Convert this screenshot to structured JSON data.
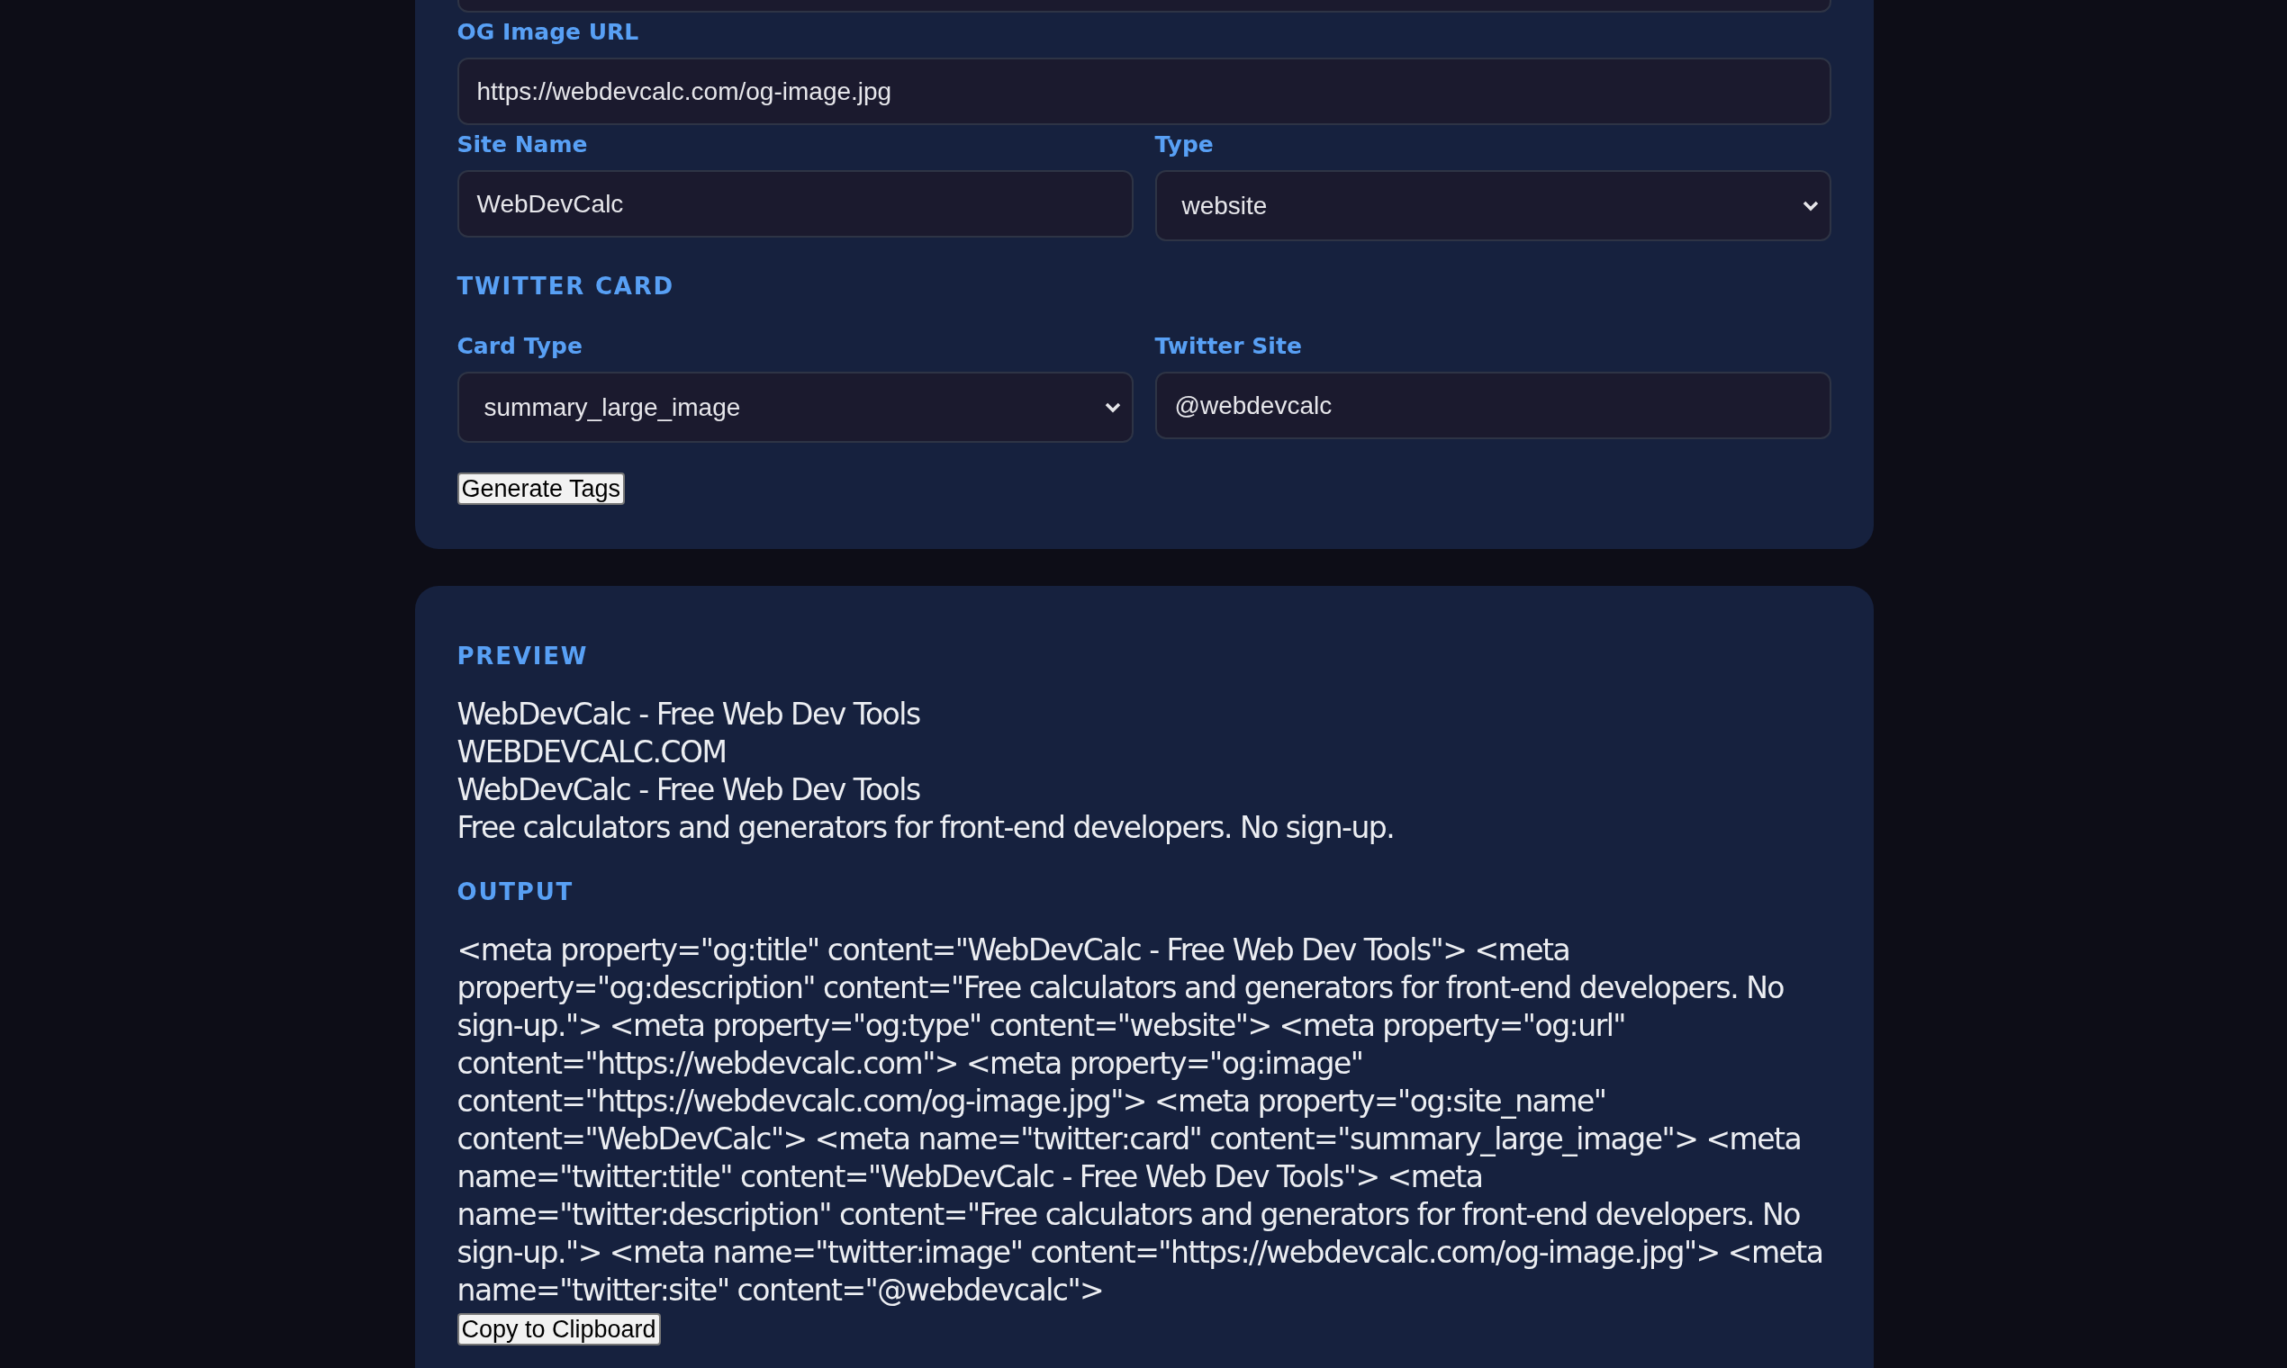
{
  "form_card": {
    "items": [
      {
        "kind": "cut_field"
      },
      {
        "kind": "input",
        "label": "OG Image URL",
        "value": "https://webdevcalc.com/og-image.jpg"
      },
      {
        "kind": "pair",
        "fields": [
          {
            "kind": "input",
            "label": "Site Name",
            "value": "WebDevCalc"
          },
          {
            "kind": "select",
            "label": "Type",
            "value": "website"
          }
        ]
      },
      {
        "kind": "heading",
        "text": "TWITTER CARD"
      },
      {
        "kind": "pair",
        "fields": [
          {
            "kind": "select",
            "label": "Card Type",
            "value": "summary_large_image"
          },
          {
            "kind": "input",
            "label": "Twitter Site",
            "value": "@webdevcalc"
          }
        ]
      },
      {
        "kind": "button",
        "label": "Generate Tags"
      }
    ]
  },
  "result_card": {
    "preview": {
      "heading": "PREVIEW",
      "lines": [
        "WebDevCalc - Free Web Dev Tools",
        "WEBDEVCALC.COM",
        "WebDevCalc - Free Web Dev Tools",
        "Free calculators and generators for front-end developers. No sign-up."
      ]
    },
    "output": {
      "heading": "OUTPUT",
      "code": "<meta property=\"og:title\" content=\"WebDevCalc - Free Web Dev Tools\"> <meta property=\"og:description\" content=\"Free calculators and generators for front-end developers. No sign-up.\"> <meta property=\"og:type\" content=\"website\"> <meta property=\"og:url\" content=\"https://webdevcalc.com\"> <meta property=\"og:image\" content=\"https://webdevcalc.com/og-image.jpg\"> <meta property=\"og:site_name\" content=\"WebDevCalc\"> <meta name=\"twitter:card\" content=\"summary_large_image\"> <meta name=\"twitter:title\" content=\"WebDevCalc - Free Web Dev Tools\"> <meta name=\"twitter:description\" content=\"Free calculators and generators for front-end developers. No sign-up.\"> <meta name=\"twitter:image\" content=\"https://webdevcalc.com/og-image.jpg\"> <meta name=\"twitter:site\" content=\"@webdevcalc\">"
    },
    "button": "Copy to Clipboard"
  }
}
